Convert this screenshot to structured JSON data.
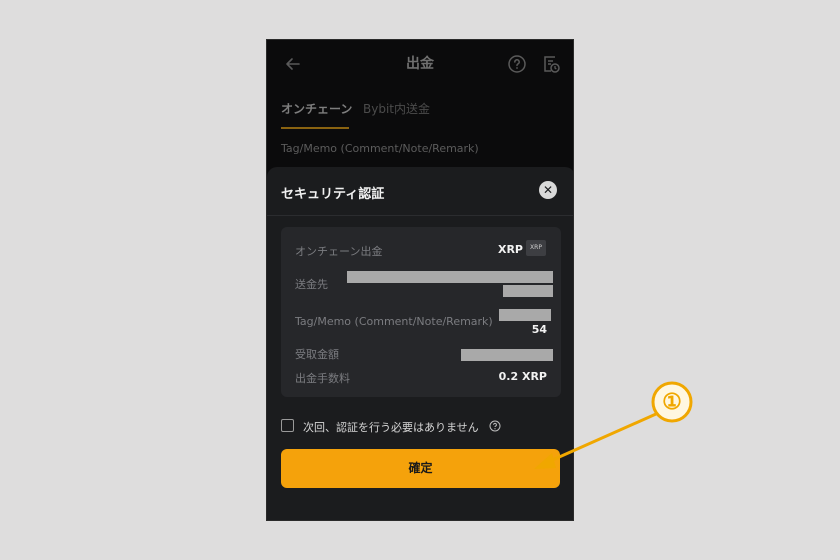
{
  "header": {
    "title": "出金",
    "back_icon": "arrow-left-icon",
    "help_icon": "question-circle-icon",
    "history_icon": "history-document-icon"
  },
  "tabs": [
    {
      "label": "オンチェーン",
      "active": true
    },
    {
      "label": "Bybit内送金",
      "active": false
    }
  ],
  "background_field_label": "Tag/Memo (Comment/Note/Remark)",
  "modal": {
    "title": "セキュリティ認証",
    "close_icon": "close-icon",
    "rows": {
      "onchain": {
        "label": "オンチェーン出金",
        "value": "XRP",
        "badge": "XRP"
      },
      "destination": {
        "label": "送金先",
        "value": ""
      },
      "tag": {
        "label": "Tag/Memo (Comment/Note/Remark)",
        "value": "54"
      },
      "amount": {
        "label": "受取金額",
        "value": ""
      },
      "fee": {
        "label": "出金手数料",
        "value": "0.2 XRP"
      }
    },
    "checkbox_label": "次回、認証を行う必要はありません",
    "checkbox_checked": false,
    "confirm_label": "確定"
  },
  "annotation": {
    "step": "①",
    "color": "#f0a700"
  },
  "colors": {
    "accent": "#f5a20b",
    "sheet_bg": "#1b1c1e",
    "card_bg": "#26272a",
    "page_bg": "#dedddd"
  }
}
